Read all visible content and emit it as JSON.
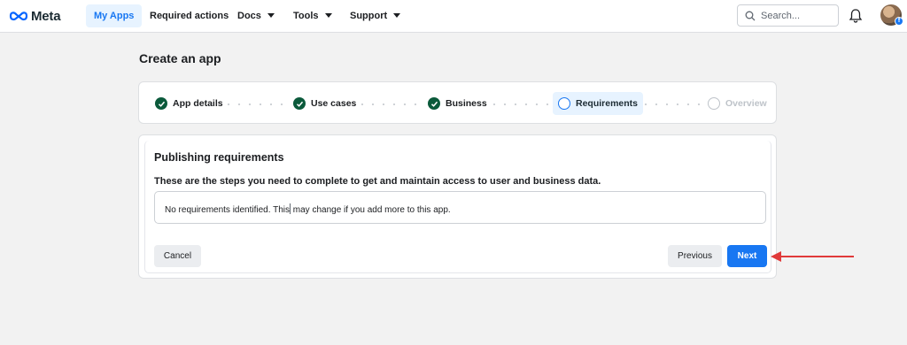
{
  "brand": {
    "name": "Meta",
    "accent": "#1877f2",
    "check_color": "#0b5a3b",
    "arrow_color": "#e03a3a"
  },
  "nav": {
    "items": [
      {
        "label": "My Apps",
        "active": true
      },
      {
        "label": "Required actions",
        "active": false
      },
      {
        "label": "Docs",
        "dropdown": true
      },
      {
        "label": "Tools",
        "dropdown": true
      },
      {
        "label": "Support",
        "dropdown": true
      }
    ],
    "search_placeholder": "Search...",
    "icons": [
      "search-icon",
      "bell-icon",
      "avatar",
      "facebook-badge-icon"
    ]
  },
  "page": {
    "title": "Create an app"
  },
  "stepper": {
    "steps": [
      {
        "label": "App details",
        "state": "complete"
      },
      {
        "label": "Use cases",
        "state": "complete"
      },
      {
        "label": "Business",
        "state": "complete"
      },
      {
        "label": "Requirements",
        "state": "current"
      },
      {
        "label": "Overview",
        "state": "upcoming"
      }
    ]
  },
  "requirements": {
    "title": "Publishing requirements",
    "subtitle": "These are the steps you need to complete to get and maintain access to user and business data.",
    "message_part1": "No requirements identified. This",
    "message_part2": " may change if you add more to this app."
  },
  "buttons": {
    "cancel": "Cancel",
    "previous": "Previous",
    "next": "Next"
  }
}
